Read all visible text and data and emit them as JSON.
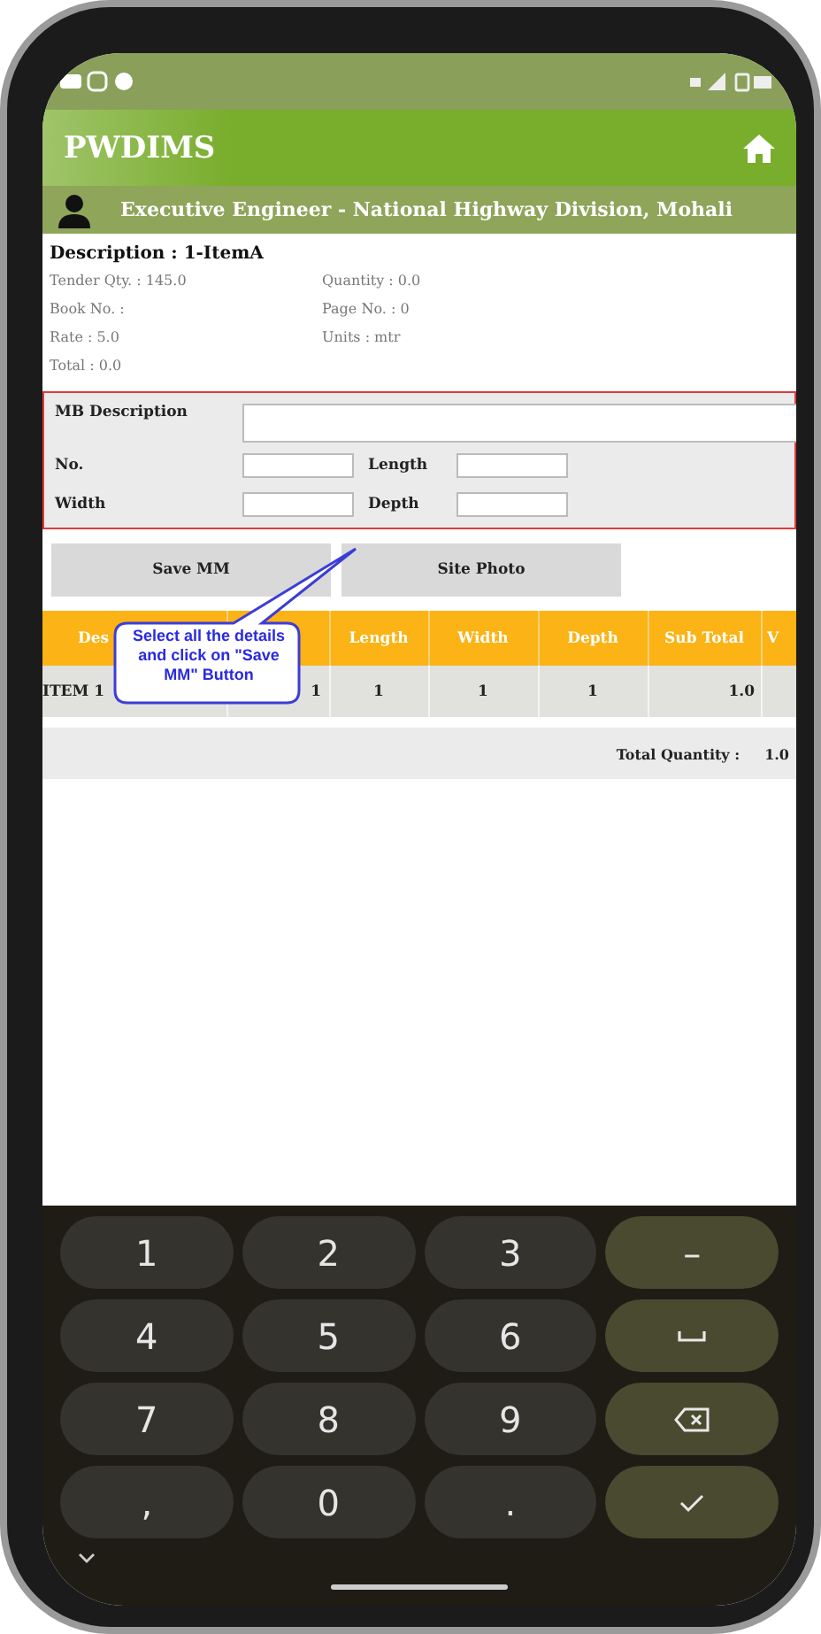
{
  "app_bar": {
    "title": "PWDIMS"
  },
  "user_bar": {
    "title": "Executive Engineer - National Highway Division, Mohali"
  },
  "details": {
    "description": "Description : 1-ItemA",
    "fields": [
      "Tender Qty. : 145.0",
      "Quantity : 0.0",
      "Book No. :",
      "Page No. : 0",
      "Rate : 5.0",
      "Units : mtr",
      "Total : 0.0"
    ]
  },
  "form": {
    "mb_description_label": "MB Description",
    "fields": [
      {
        "label": "No."
      },
      {
        "label": "Length"
      },
      {
        "label": "Width"
      },
      {
        "label": "Depth"
      }
    ]
  },
  "buttons": [
    "Save MM",
    "Site Photo"
  ],
  "table": {
    "columns": [
      {
        "label": "Des"
      },
      {},
      {
        "label": "Length"
      },
      {
        "label": "Width"
      },
      {
        "label": "Depth"
      },
      {
        "label": "Sub Total"
      },
      {
        "label": "V"
      }
    ],
    "rows": [
      [
        "ITEM 1",
        "1",
        "1",
        "1",
        "1",
        "1.0"
      ]
    ],
    "total_label": "Total Quantity :",
    "total_value": "1.0"
  },
  "callout": {
    "text": "Select all the details and click on \"Save MM\" Button"
  },
  "keyboard": {
    "rows": [
      [
        {
          "kind": "key",
          "label": "1"
        },
        {
          "kind": "key",
          "label": "2"
        },
        {
          "kind": "key",
          "label": "3"
        },
        {
          "kind": "fn",
          "label": "–"
        }
      ],
      [
        {
          "kind": "key",
          "label": "4"
        },
        {
          "kind": "key",
          "label": "5"
        },
        {
          "kind": "key",
          "label": "6"
        },
        {
          "kind": "space"
        }
      ],
      [
        {
          "kind": "key",
          "label": "7"
        },
        {
          "kind": "key",
          "label": "8"
        },
        {
          "kind": "key",
          "label": "9"
        },
        {
          "kind": "backspace"
        }
      ],
      [
        {
          "kind": "key",
          "label": ","
        },
        {
          "kind": "key",
          "label": "0"
        },
        {
          "kind": "key",
          "label": "."
        },
        {
          "kind": "done"
        }
      ]
    ]
  }
}
